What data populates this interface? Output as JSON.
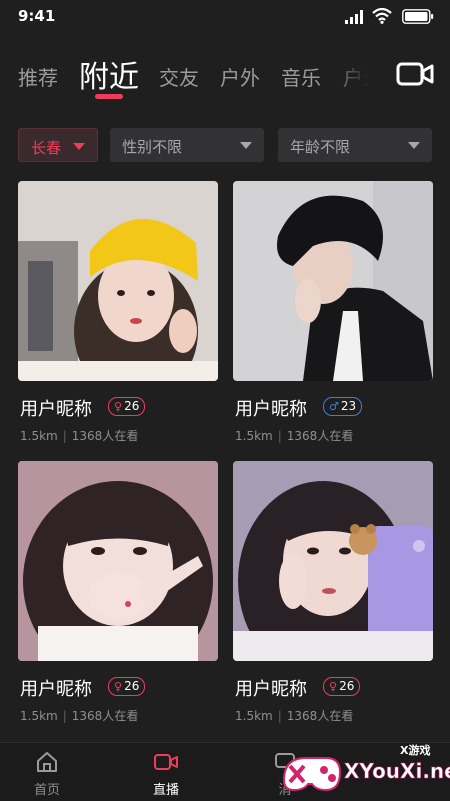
{
  "status_bar": {
    "time": "9:41"
  },
  "tabs": [
    {
      "label": "推荐",
      "active": false
    },
    {
      "label": "附近",
      "active": true
    },
    {
      "label": "交友",
      "active": false
    },
    {
      "label": "户外",
      "active": false
    },
    {
      "label": "音乐",
      "active": false
    },
    {
      "label": "户外",
      "active": false
    }
  ],
  "filters": {
    "city": "长春",
    "gender": "性别不限",
    "age": "年龄不限"
  },
  "cards": [
    {
      "name": "用户昵称",
      "gender": "female",
      "age": "26",
      "distance": "1.5km",
      "viewers": "1368人在看"
    },
    {
      "name": "用户昵称",
      "gender": "male",
      "age": "23",
      "distance": "1.5km",
      "viewers": "1368人在看"
    },
    {
      "name": "用户昵称",
      "gender": "female",
      "age": "26",
      "distance": "1.5km",
      "viewers": "1368人在看"
    },
    {
      "name": "用户昵称",
      "gender": "female",
      "age": "26",
      "distance": "1.5km",
      "viewers": "1368人在看"
    }
  ],
  "bottom_nav": [
    {
      "label": "首页",
      "icon": "home-icon",
      "active": false
    },
    {
      "label": "直播",
      "icon": "live-camera-icon",
      "active": true
    },
    {
      "label": "消",
      "icon": "message-icon",
      "active": false
    }
  ],
  "watermark": {
    "line1": "X游戏",
    "line2": "XYouXi.net"
  },
  "colors": {
    "accent": "#ee3d5a",
    "male": "#3a7fe0",
    "background": "#1f1f20"
  }
}
